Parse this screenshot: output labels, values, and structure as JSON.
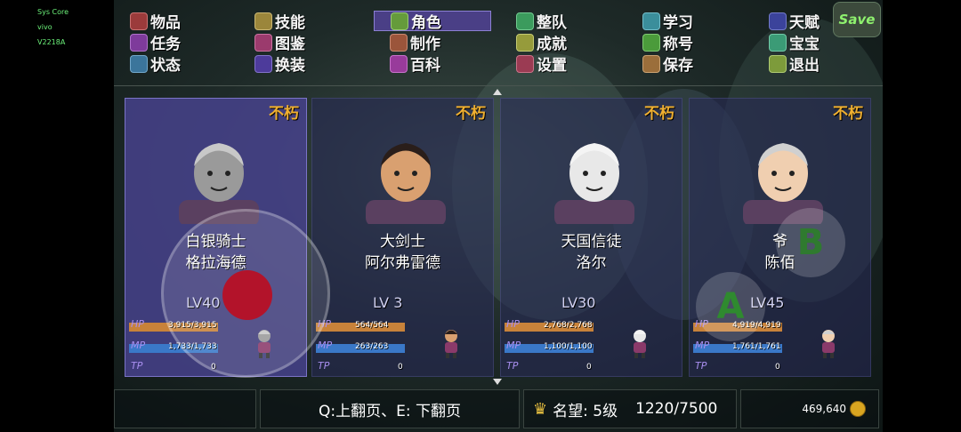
{
  "system": {
    "line1": "Sys Core",
    "line2": "vivo",
    "line3": "V2218A"
  },
  "menu": [
    {
      "label": "物品",
      "icon": "bag-icon"
    },
    {
      "label": "技能",
      "icon": "sword-icon"
    },
    {
      "label": "角色",
      "icon": "mask-icon",
      "active": true
    },
    {
      "label": "整队",
      "icon": "flag-icon"
    },
    {
      "label": "学习",
      "icon": "book-icon"
    },
    {
      "label": "天赋",
      "icon": "potion-icon"
    },
    {
      "label": "任务",
      "icon": "scroll-icon"
    },
    {
      "label": "图鉴",
      "icon": "album-icon"
    },
    {
      "label": "制作",
      "icon": "anvil-icon"
    },
    {
      "label": "成就",
      "icon": "trophy-icon"
    },
    {
      "label": "称号",
      "icon": "medal-icon"
    },
    {
      "label": "宝宝",
      "icon": "pet-icon"
    },
    {
      "label": "状态",
      "icon": "status-icon"
    },
    {
      "label": "换装",
      "icon": "hanger-icon"
    },
    {
      "label": "百科",
      "icon": "encyclopedia-icon"
    },
    {
      "label": "设置",
      "icon": "gear-icon"
    },
    {
      "label": "保存",
      "icon": "floppy-icon"
    },
    {
      "label": "退出",
      "icon": "exit-icon"
    }
  ],
  "save_button": "Save",
  "characters": [
    {
      "badge": "不朽",
      "title": "白银骑士",
      "name": "格拉海德",
      "level": "LV40",
      "hp_label": "HP",
      "hp": "3,915/3,915",
      "mp_label": "MP",
      "mp": "1,733/1,733",
      "tp_label": "TP",
      "tp": "0",
      "selected": true
    },
    {
      "badge": "不朽",
      "title": "大剑士",
      "name": "阿尔弗雷德",
      "level": "LV 3",
      "hp_label": "HP",
      "hp": "564/564",
      "mp_label": "MP",
      "mp": "263/263",
      "tp_label": "TP",
      "tp": "0"
    },
    {
      "badge": "不朽",
      "title": "天国信徒",
      "name": "洛尔",
      "level": "LV30",
      "hp_label": "HP",
      "hp": "2,768/2,768",
      "mp_label": "MP",
      "mp": "1,100/1,100",
      "tp_label": "TP",
      "tp": "0"
    },
    {
      "badge": "不朽",
      "title": "爷",
      "name": "陈佰",
      "level": "LV45",
      "hp_label": "HP",
      "hp": "4,919/4,919",
      "mp_label": "MP",
      "mp": "1,761/1,761",
      "tp_label": "TP",
      "tp": "0"
    }
  ],
  "footer": {
    "page_hint": "Q:上翻页、E: 下翻页",
    "reputation": "名望: 5级",
    "reputation_progress": "1220/7500",
    "gold": "469,640"
  },
  "controls": {
    "button_a": "A",
    "button_b": "B"
  },
  "colors": {
    "hp_bar": "#c8823a",
    "mp_bar": "#3a78c8",
    "badge": "#f0b030",
    "active_menu": "#4a3f86"
  }
}
